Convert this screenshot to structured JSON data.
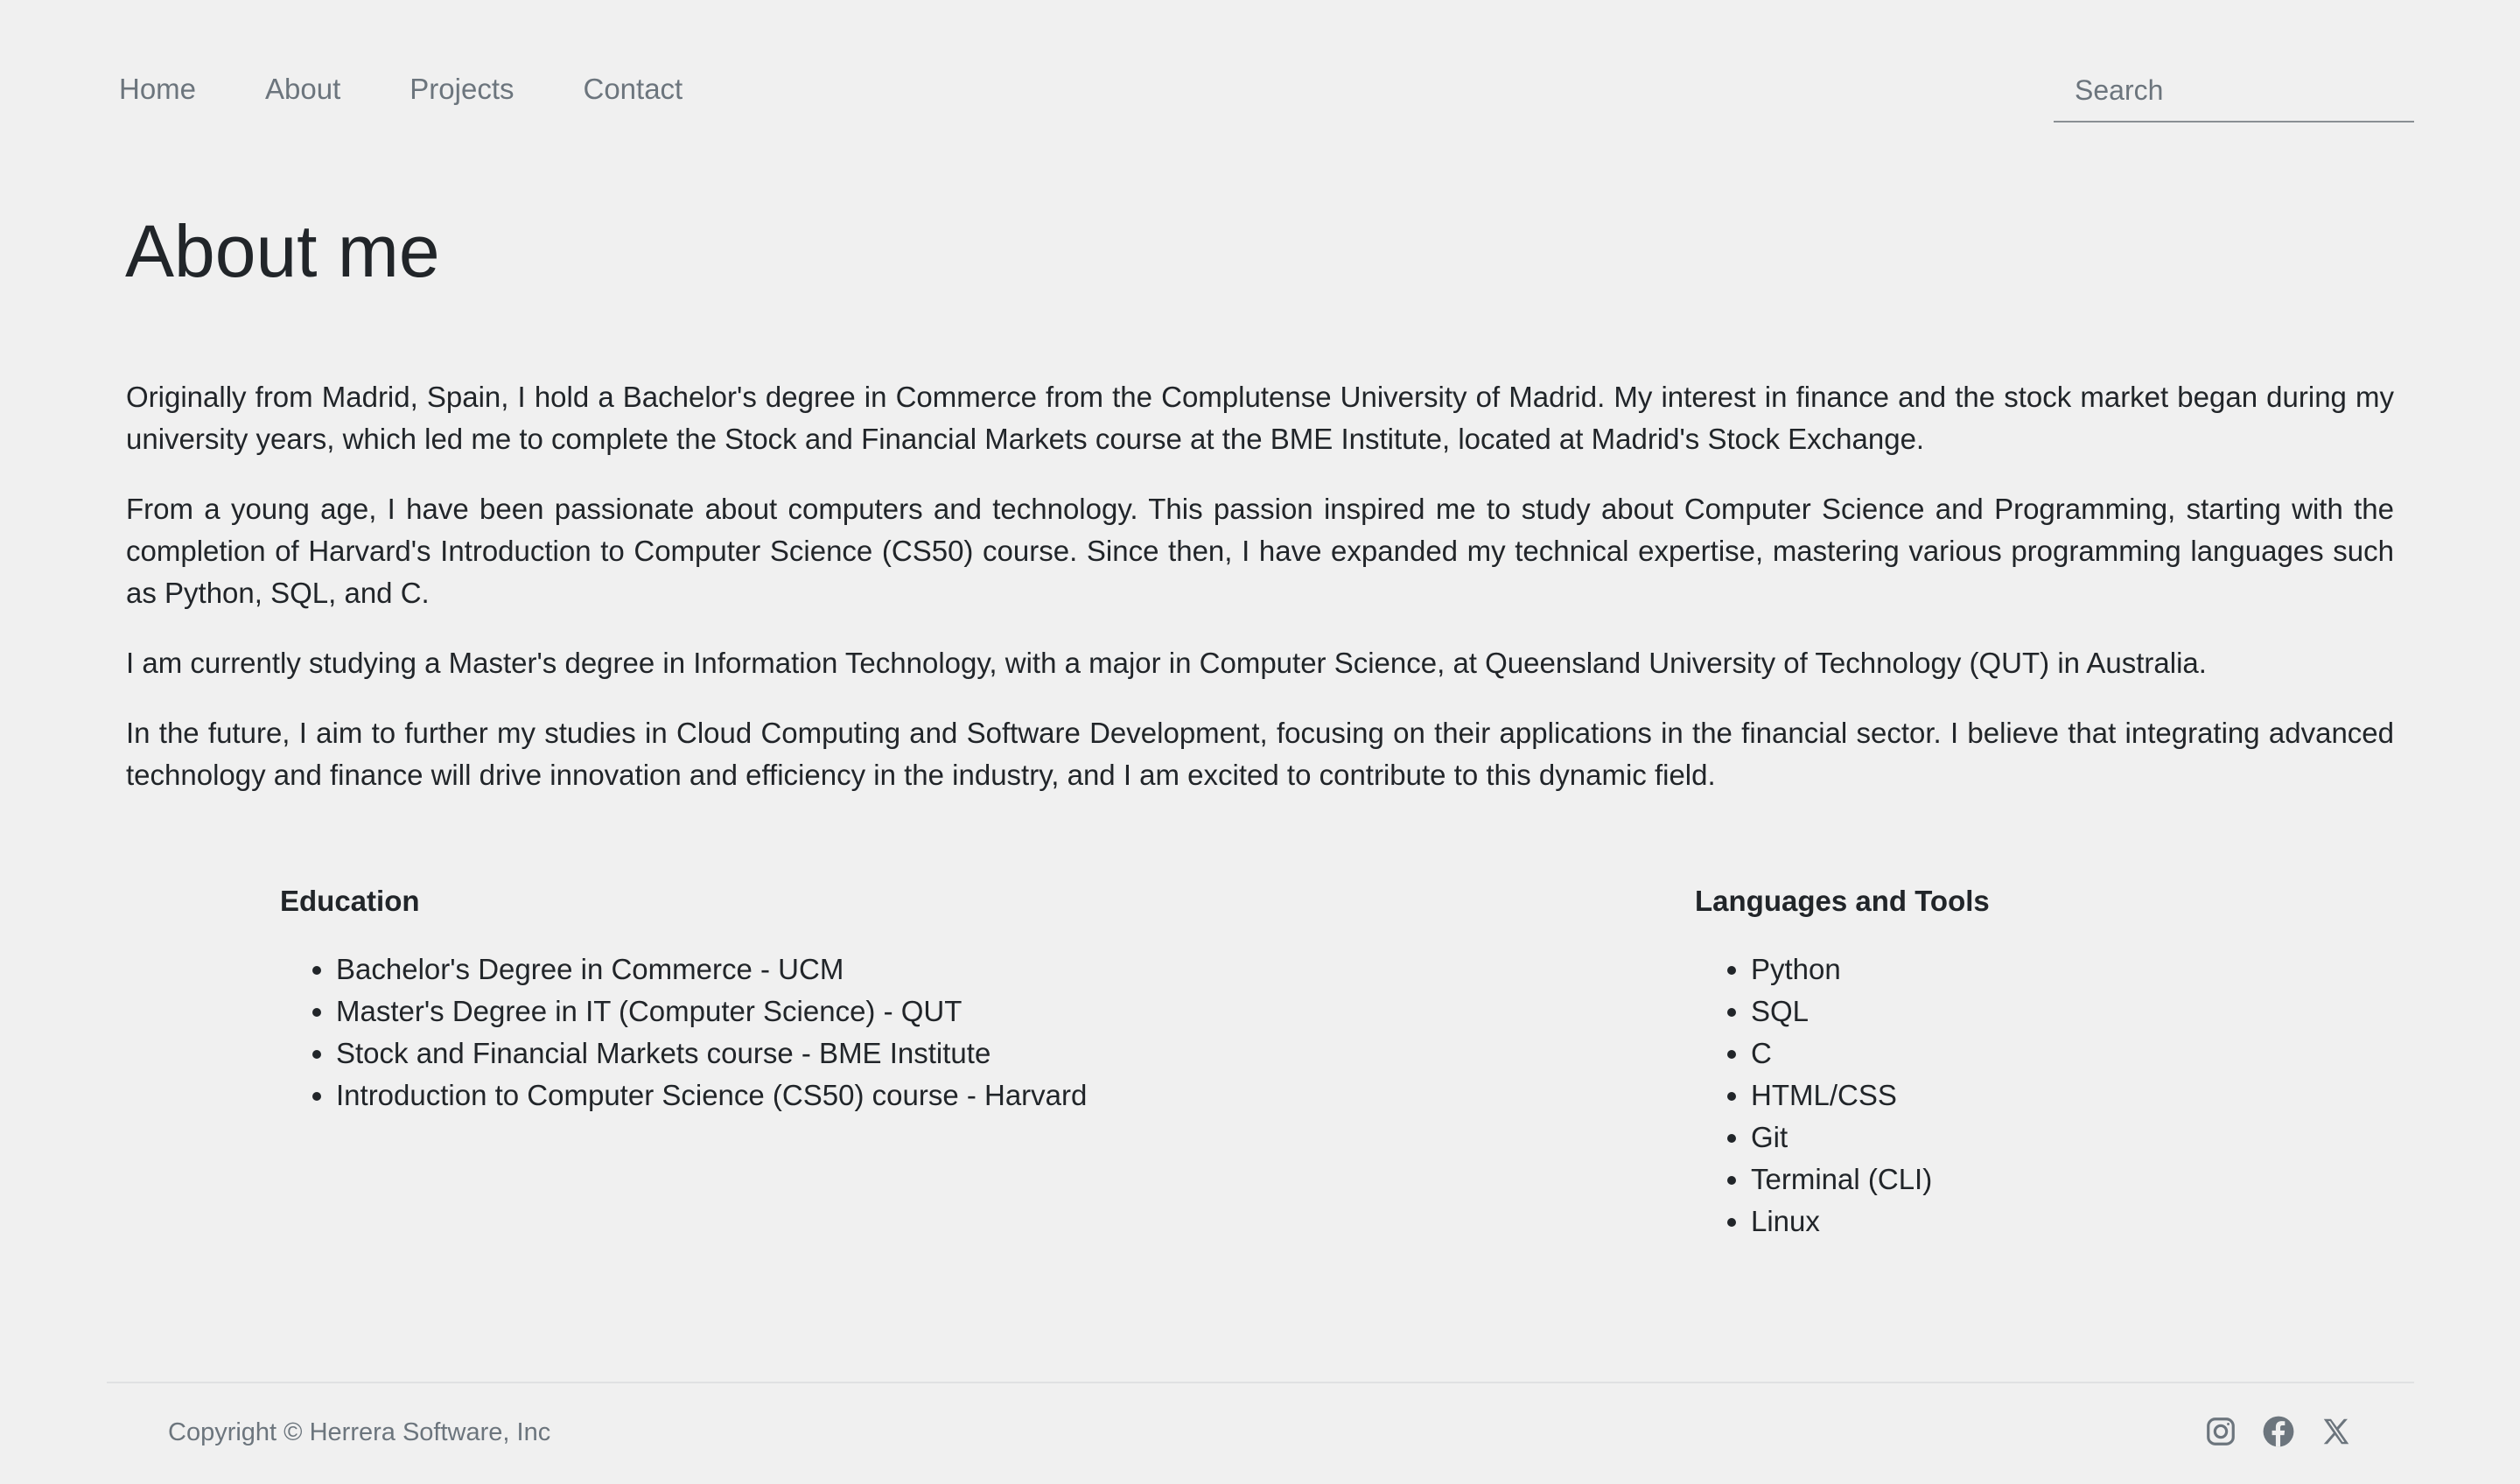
{
  "nav": {
    "links": [
      "Home",
      "About",
      "Projects",
      "Contact"
    ],
    "search_placeholder": "Search"
  },
  "page": {
    "title": "About me",
    "paragraphs": [
      "Originally from Madrid, Spain, I hold a Bachelor's degree in Commerce from the Complutense University of Madrid. My interest in finance and the stock market began during my university years, which led me to complete the Stock and Financial Markets course at the BME Institute, located at Madrid's Stock Exchange.",
      "From a young age, I have been passionate about computers and technology. This passion inspired me to study about Computer Science and Programming, starting with the completion of Harvard's Introduction to Computer Science (CS50) course. Since then, I have expanded my technical expertise, mastering various programming languages such as Python, SQL, and C.",
      "I am currently studying a Master's degree in Information Technology, with a major in Computer Science, at Queensland University of Technology (QUT) in Australia.",
      "In the future, I aim to further my studies in Cloud Computing and Software Development, focusing on their applications in the financial sector. I believe that integrating advanced technology and finance will drive innovation and efficiency in the industry, and I am excited to contribute to this dynamic field."
    ]
  },
  "education": {
    "heading": "Education",
    "items": [
      "Bachelor's Degree in Commerce - UCM",
      "Master's Degree in IT (Computer Science) - QUT",
      "Stock and Financial Markets course - BME Institute",
      "Introduction to Computer Science (CS50) course - Harvard"
    ]
  },
  "tools": {
    "heading": "Languages and Tools",
    "items": [
      "Python",
      "SQL",
      "C",
      "HTML/CSS",
      "Git",
      "Terminal (CLI)",
      "Linux"
    ]
  },
  "footer": {
    "copyright": "Copyright © Herrera Software, Inc",
    "social_icons": [
      "instagram-icon",
      "facebook-icon",
      "x-twitter-icon"
    ]
  },
  "colors": {
    "background": "#f0f0f0",
    "text": "#212529",
    "muted": "#6c757d"
  }
}
